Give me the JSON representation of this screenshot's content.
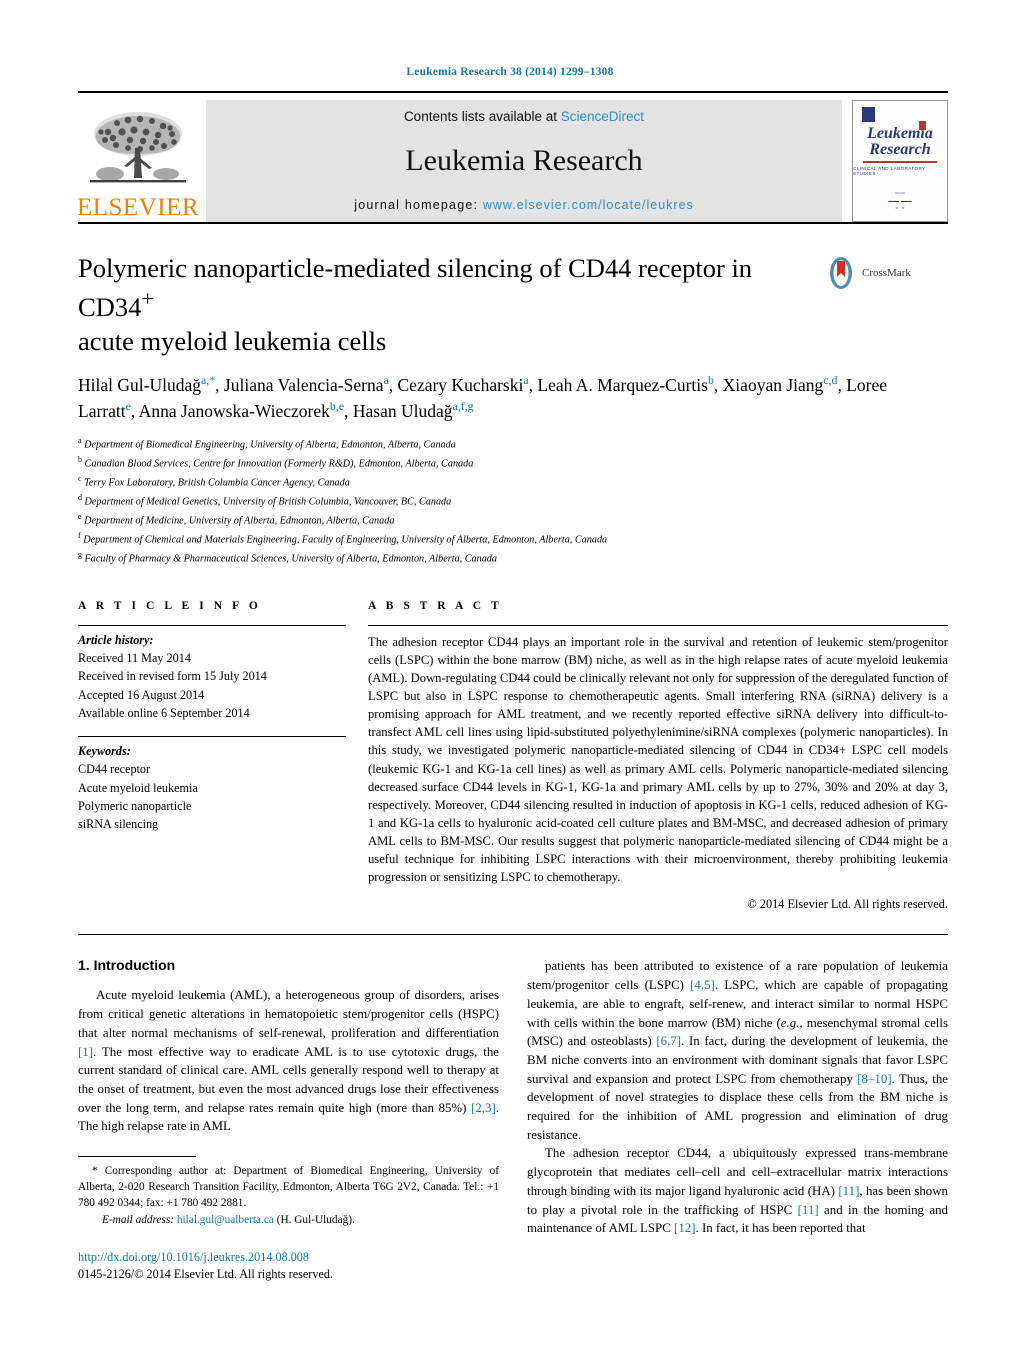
{
  "running_head": "Leukemia Research 38 (2014) 1299–1308",
  "masthead": {
    "publisher_name": "ELSEVIER",
    "contents_prefix": "Contents lists available at ",
    "contents_link": "ScienceDirect",
    "journal_title": "Leukemia Research",
    "homepage_label": "journal homepage: ",
    "homepage_url": "www.elsevier.com/locate/leukres",
    "cover": {
      "line1": "Leukemia",
      "line2": "Research",
      "subtitle": "Clinical and Laboratory Studies"
    }
  },
  "article": {
    "title_line1": "Polymeric nanoparticle-mediated silencing of CD44 receptor in CD34",
    "title_sup": "+",
    "title_line2": "acute myeloid leukemia cells",
    "crossmark_label": "CrossMark",
    "authors_html": "Hilal Gul-Uludağ<sup>a,*</sup>, Juliana Valencia-Serna<sup>a</sup>, Cezary Kucharski<sup>a</sup>, Leah A. Marquez-Curtis<sup>b</sup>, Xiaoyan Jiang<sup>c,d</sup>, Loree Larratt<sup>e</sup>, Anna Janowska-Wieczorek<sup>b,e</sup>, Hasan Uludağ<sup>a,f,g</sup>",
    "affiliations": [
      {
        "mark": "a",
        "text": "Department of Biomedical Engineering, University of Alberta, Edmonton, Alberta, Canada"
      },
      {
        "mark": "b",
        "text": "Canadian Blood Services, Centre for Innovation (Formerly R&D), Edmonton, Alberta, Canada"
      },
      {
        "mark": "c",
        "text": "Terry Fox Laboratory, British Columbia Cancer Agency, Canada"
      },
      {
        "mark": "d",
        "text": "Department of Medical Genetics, University of British Columbia, Vancouver, BC, Canada"
      },
      {
        "mark": "e",
        "text": "Department of Medicine, University of Alberta, Edmonton, Alberta, Canada"
      },
      {
        "mark": "f",
        "text": "Department of Chemical and Materials Engineering, Faculty of Engineering, University of Alberta, Edmonton, Alberta, Canada"
      },
      {
        "mark": "g",
        "text": "Faculty of Pharmacy & Pharmaceutical Sciences, University of Alberta, Edmonton, Alberta, Canada"
      }
    ]
  },
  "article_info": {
    "heading": "A R T I C L E   I N F O",
    "history_label": "Article history:",
    "history": [
      "Received 11 May 2014",
      "Received in revised form 15 July 2014",
      "Accepted 16 August 2014",
      "Available online 6 September 2014"
    ],
    "keywords_label": "Keywords:",
    "keywords": [
      "CD44 receptor",
      "Acute myeloid leukemia",
      "Polymeric nanoparticle",
      "siRNA silencing"
    ]
  },
  "abstract": {
    "heading": "A B S T R A C T",
    "text": "The adhesion receptor CD44 plays an important role in the survival and retention of leukemic stem/progenitor cells (LSPC) within the bone marrow (BM) niche, as well as in the high relapse rates of acute myeloid leukemia (AML). Down-regulating CD44 could be clinically relevant not only for suppression of the deregulated function of LSPC but also in LSPC response to chemotherapeutic agents. Small interfering RNA (siRNA) delivery is a promising approach for AML treatment, and we recently reported effective siRNA delivery into difficult-to-transfect AML cell lines using lipid-substituted polyethylenimine/siRNA complexes (polymeric nanoparticles). In this study, we investigated polymeric nanoparticle-mediated silencing of CD44 in CD34+ LSPC cell models (leukemic KG-1 and KG-1a cell lines) as well as primary AML cells. Polymeric nanoparticle-mediated silencing decreased surface CD44 levels in KG-1, KG-1a and primary AML cells by up to 27%, 30% and 20% at day 3, respectively. Moreover, CD44 silencing resulted in induction of apoptosis in KG-1 cells, reduced adhesion of KG-1 and KG-1a cells to hyaluronic acid-coated cell culture plates and BM-MSC, and decreased adhesion of primary AML cells to BM-MSC. Our results suggest that polymeric nanoparticle-mediated silencing of CD44 might be a useful technique for inhibiting LSPC interactions with their microenvironment, thereby prohibiting leukemia progression or sensitizing LSPC to chemotherapy.",
    "copyright": "© 2014 Elsevier Ltd. All rights reserved."
  },
  "introduction": {
    "heading": "1.  Introduction",
    "left_paragraph_html": "Acute myeloid leukemia (AML), a heterogeneous group of disorders, arises from critical genetic alterations in hematopoietic stem/progenitor cells (HSPC) that alter normal mechanisms of self-renewal, proliferation and differentiation <span class=\"ref\">[1]</span>. The most effective way to eradicate AML is to use cytotoxic drugs, the current standard of clinical care. AML cells generally respond well to therapy at the onset of treatment, but even the most advanced drugs lose their effectiveness over the long term, and relapse rates remain quite high (more than 85%) <span class=\"ref\">[2,3]</span>. The high relapse rate in AML",
    "right_paragraph1_html": "patients has been attributed to existence of a rare population of leukemia stem/progenitor cells (LSPC) <span class=\"ref\">[4,5]</span>. LSPC, which are capable of propagating leukemia, are able to engraft, self-renew, and interact similar to normal HSPC with cells within the bone marrow (BM) niche (<i>e.g.,</i> mesenchymal stromal cells (MSC) and osteoblasts) <span class=\"ref\">[6,7]</span>. In fact, during the development of leukemia, the BM niche converts into an environment with dominant signals that favor LSPC survival and expansion and protect LSPC from chemotherapy <span class=\"ref\">[8–10]</span>. Thus, the development of novel strategies to displace these cells from the BM niche is required for the inhibition of AML progression and elimination of drug resistance.",
    "right_paragraph2_html": "The adhesion receptor CD44, a ubiquitously expressed trans-membrane glycoprotein that mediates cell–cell and cell–extracellular matrix interactions through binding with its major ligand hyaluronic acid (HA) <span class=\"ref\">[11]</span>, has been shown to play a pivotal role in the trafficking of HSPC <span class=\"ref\">[11]</span> and in the homing and maintenance of AML LSPC <span class=\"ref\">[12]</span>. In fact, it has been reported that"
  },
  "footer": {
    "corresponding_note": "* Corresponding author at: Department of Biomedical Engineering, University of Alberta, 2-020 Research Transition Facility, Edmonton, Alberta T6G 2V2, Canada. Tel.: +1 780 492 0344; fax: +1 780 492 2881.",
    "email_label": "E-mail address:",
    "email": "hilal.gul@ualberta.ca",
    "email_suffix": "(H. Gul-Uludağ).",
    "doi": "http://dx.doi.org/10.1016/j.leukres.2014.08.008",
    "issn": "0145-2126/© 2014 Elsevier Ltd. All rights reserved."
  },
  "colors": {
    "link_blue": "#1277a8",
    "sciencedirect_blue": "#2e8fc4",
    "elsevier_orange": "#ef8200",
    "cover_navy": "#2b3a76",
    "cover_red": "#b03a28",
    "band_gray": "#e3e3e3"
  }
}
